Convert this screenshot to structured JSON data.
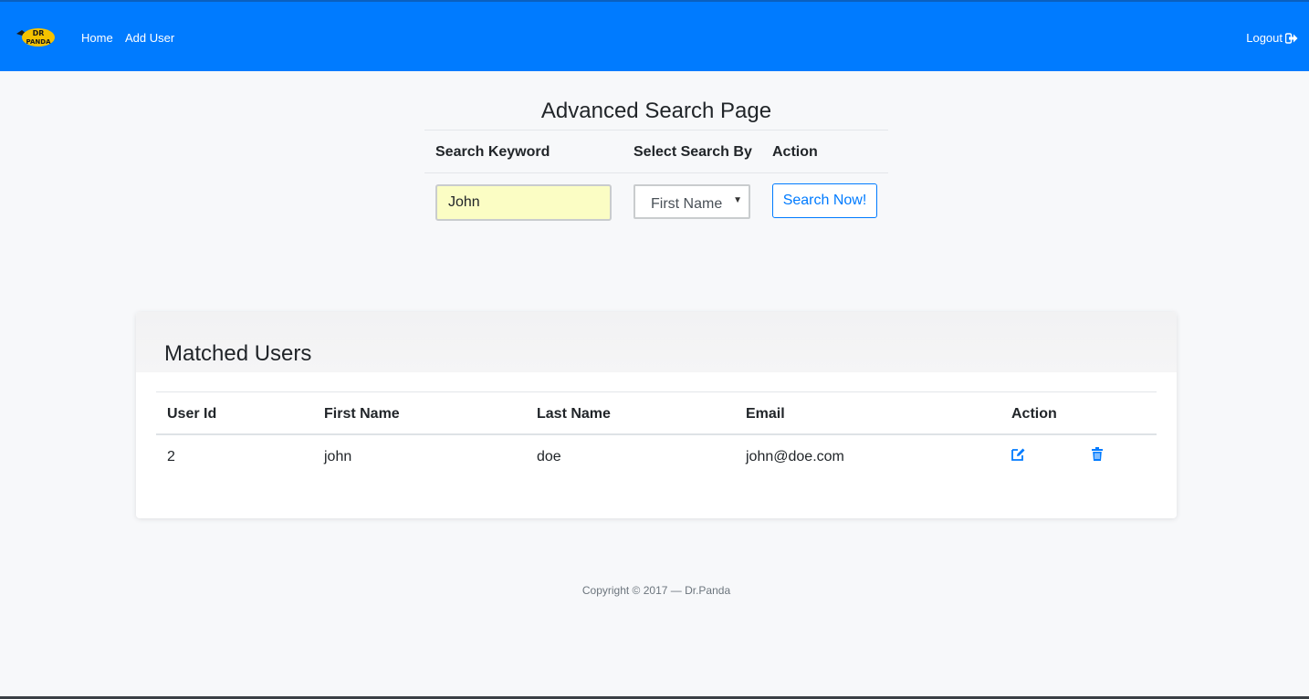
{
  "navbar": {
    "logo_text": "DR PANDA",
    "home_label": "Home",
    "add_user_label": "Add User",
    "logout_label": "Logout",
    "logout_icon": "sign-out-icon",
    "background": "#007bff"
  },
  "search": {
    "title": "Advanced Search Page",
    "headers": {
      "keyword": "Search Keyword",
      "search_by": "Select Search By",
      "action": "Action"
    },
    "keyword_value": "John",
    "search_by_selected": "First Name",
    "button_label": "Search Now!"
  },
  "results": {
    "title": "Matched Users",
    "columns": [
      "User Id",
      "First Name",
      "Last Name",
      "Email",
      "Action"
    ],
    "rows": [
      {
        "id": "2",
        "first_name": "john",
        "last_name": "doe",
        "email": "john@doe.com",
        "edit_icon": "edit-icon",
        "delete_icon": "trash-icon"
      }
    ]
  },
  "footer": {
    "copyright": "Copyright © 2017 — Dr.Panda"
  },
  "colors": {
    "accent": "#007bff",
    "keyword_bg": "#fbfdc4"
  }
}
